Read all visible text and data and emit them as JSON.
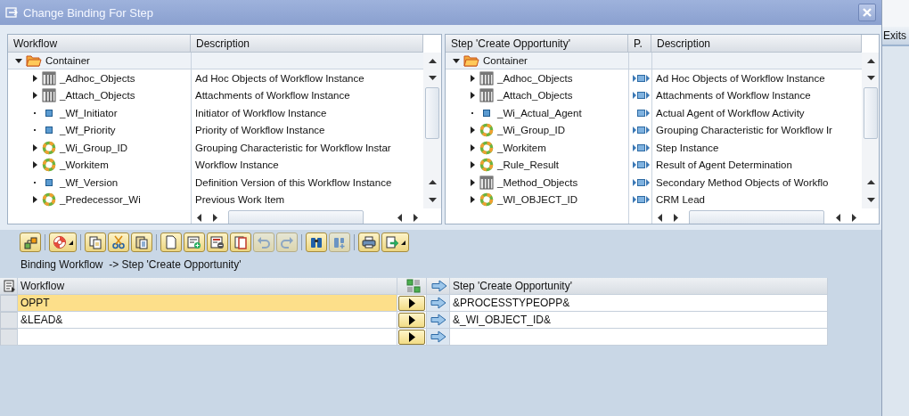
{
  "window": {
    "title": "Change Binding For Step"
  },
  "side_tab": {
    "label": "Exits"
  },
  "workflow_tree": {
    "columns": [
      "Workflow",
      "Description"
    ],
    "root": {
      "label": "Container",
      "expanded": true,
      "children": [
        {
          "name": "_Adhoc_Objects",
          "kind": "table",
          "expanded": false,
          "description": "Ad Hoc Objects of Workflow Instance"
        },
        {
          "name": "_Attach_Objects",
          "kind": "table",
          "expanded": false,
          "description": "Attachments of Workflow Instance"
        },
        {
          "name": "_Wf_Initiator",
          "kind": "element",
          "description": "Initiator of Workflow Instance"
        },
        {
          "name": "_Wf_Priority",
          "kind": "element",
          "description": "Priority of Workflow Instance"
        },
        {
          "name": "_Wi_Group_ID",
          "kind": "object",
          "expanded": false,
          "description": "Grouping Characteristic for Workflow Instar"
        },
        {
          "name": "_Workitem",
          "kind": "object",
          "expanded": false,
          "description": "Workflow Instance"
        },
        {
          "name": "_Wf_Version",
          "kind": "element",
          "description": "Definition Version of this Workflow Instance"
        },
        {
          "name": "_Predecessor_Wi",
          "kind": "object",
          "expanded": false,
          "description": "Previous Work Item"
        }
      ]
    }
  },
  "step_tree": {
    "columns": [
      "Step 'Create Opportunity'",
      "P.",
      "Description"
    ],
    "root": {
      "label": "Container",
      "expanded": true,
      "children": [
        {
          "name": "_Adhoc_Objects",
          "kind": "table",
          "expanded": false,
          "import": true,
          "export": true,
          "description": "Ad Hoc Objects of Workflow Instance"
        },
        {
          "name": "_Attach_Objects",
          "kind": "table",
          "expanded": false,
          "import": true,
          "export": true,
          "description": "Attachments of Workflow Instance"
        },
        {
          "name": "_Wi_Actual_Agent",
          "kind": "element",
          "import": false,
          "export": true,
          "description": "Actual Agent of Workflow Activity"
        },
        {
          "name": "_Wi_Group_ID",
          "kind": "object",
          "expanded": false,
          "import": true,
          "export": true,
          "description": "Grouping Characteristic for Workflow Ir"
        },
        {
          "name": "_Workitem",
          "kind": "object",
          "expanded": false,
          "import": true,
          "export": true,
          "description": "Step Instance"
        },
        {
          "name": "_Rule_Result",
          "kind": "object",
          "expanded": false,
          "import": true,
          "export": true,
          "description": "Result of Agent Determination"
        },
        {
          "name": "_Method_Objects",
          "kind": "table",
          "expanded": false,
          "import": true,
          "export": true,
          "description": "Secondary Method Objects of Workflo"
        },
        {
          "name": "_WI_OBJECT_ID",
          "kind": "object",
          "expanded": false,
          "import": true,
          "export": true,
          "description": "CRM Lead"
        }
      ]
    }
  },
  "toolbar": [
    [
      {
        "kind": "hierarchy",
        "disabled": false,
        "dropdown": false
      }
    ],
    [
      {
        "kind": "help",
        "disabled": false,
        "dropdown": true
      }
    ],
    [
      {
        "kind": "copy",
        "disabled": false,
        "dropdown": false
      },
      {
        "kind": "cut",
        "disabled": false,
        "dropdown": false
      },
      {
        "kind": "paste",
        "disabled": false,
        "dropdown": false
      }
    ],
    [
      {
        "kind": "new",
        "disabled": false,
        "dropdown": false
      },
      {
        "kind": "insert_row",
        "disabled": false,
        "dropdown": false
      },
      {
        "kind": "delete_row",
        "disabled": false,
        "dropdown": false
      },
      {
        "kind": "delete",
        "disabled": false,
        "dropdown": false
      },
      {
        "kind": "undo",
        "disabled": true,
        "dropdown": false
      },
      {
        "kind": "redo",
        "disabled": true,
        "dropdown": false
      }
    ],
    [
      {
        "kind": "find",
        "disabled": false,
        "dropdown": false
      },
      {
        "kind": "find_next",
        "disabled": true,
        "dropdown": false
      }
    ],
    [
      {
        "kind": "print",
        "disabled": false,
        "dropdown": false
      },
      {
        "kind": "export",
        "disabled": false,
        "dropdown": true
      }
    ]
  ],
  "binding": {
    "title": "Binding Workflow  -> Step 'Create Opportunity'",
    "columns": {
      "workflow": "Workflow",
      "step": "Step 'Create Opportunity'"
    },
    "rows": [
      {
        "workflow": "OPPT",
        "step": "&PROCESSTYPEOPP&",
        "selected": true
      },
      {
        "workflow": "&LEAD&",
        "step": "&_WI_OBJECT_ID&",
        "selected": false
      },
      {
        "selected": false
      }
    ]
  }
}
